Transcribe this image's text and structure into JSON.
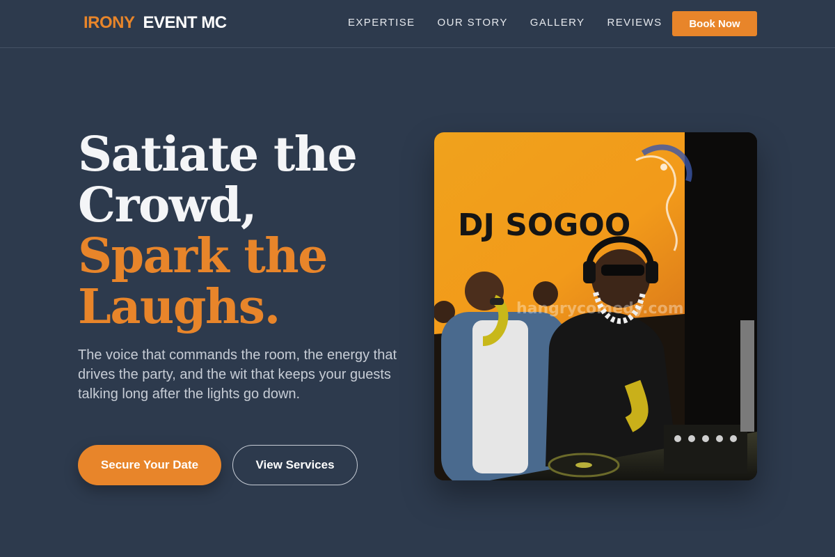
{
  "brand": {
    "accent_word": "IRONY",
    "main_words": "EVENT MC"
  },
  "nav": {
    "links": [
      "EXPERTISE",
      "OUR STORY",
      "GALLERY",
      "REVIEWS"
    ],
    "cta_label": "Book Now"
  },
  "hero": {
    "headline_white": [
      "Satiate the",
      "Crowd,"
    ],
    "headline_orange": [
      "Spark the",
      "Laughs."
    ],
    "tagline": "The voice that commands the room, the energy that drives the party, and the wit that keeps your guests talking long after the lights go down.",
    "primary_cta": "Secure Your Date",
    "secondary_cta": "View Services"
  },
  "photo": {
    "banner_text": "DJ SOGOO",
    "watermark": "hangrycomedy.com"
  },
  "colors": {
    "background": "#2d3a4d",
    "accent": "#e8852a",
    "text": "#ffffff",
    "muted_text": "#c7cdd6"
  }
}
